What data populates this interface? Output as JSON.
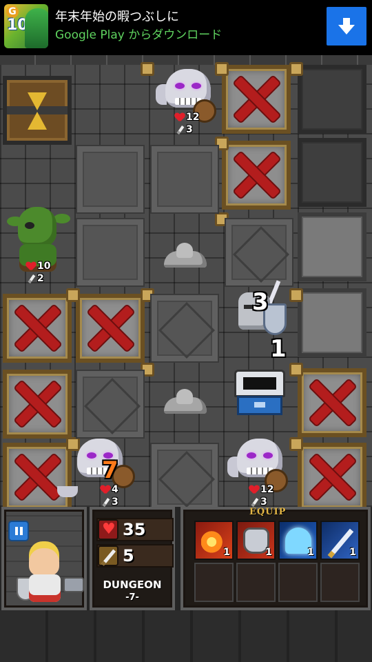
{
  "ad": {
    "title": "年末年始の暇つぶしに",
    "subtitle": "Google Play からダウンロード",
    "icon_badge": "10",
    "download_icon": "download-arrow-icon"
  },
  "board": {
    "monsters": [
      {
        "kind": "skeleton",
        "hp": "12",
        "atk": "3"
      },
      {
        "kind": "goblin",
        "hp": "10",
        "atk": "2"
      },
      {
        "kind": "skeleton",
        "hp": "4",
        "atk": "3",
        "marker": "7"
      },
      {
        "kind": "skeleton",
        "hp": "12",
        "atk": "3"
      }
    ],
    "knight": {
      "top_number": "3",
      "bottom_number": "1"
    }
  },
  "hud": {
    "pause_icon": "pause-icon",
    "hp": "35",
    "attack": "5",
    "dungeon_label": "DUNGEON",
    "dungeon_level": "-7-",
    "equip_label": "EQUIP",
    "equipment": [
      {
        "name": "fireball-icon",
        "count": "1"
      },
      {
        "name": "iron-fist-icon",
        "count": "1"
      },
      {
        "name": "ghost-icon",
        "count": "1"
      },
      {
        "name": "sword-slash-icon",
        "count": "1"
      }
    ]
  },
  "colors": {
    "ad_button": "#1a73e8",
    "blocked_x": "#b31d1d",
    "hp_heart": "#e01f2a",
    "equip_gold": "#e2b545"
  }
}
